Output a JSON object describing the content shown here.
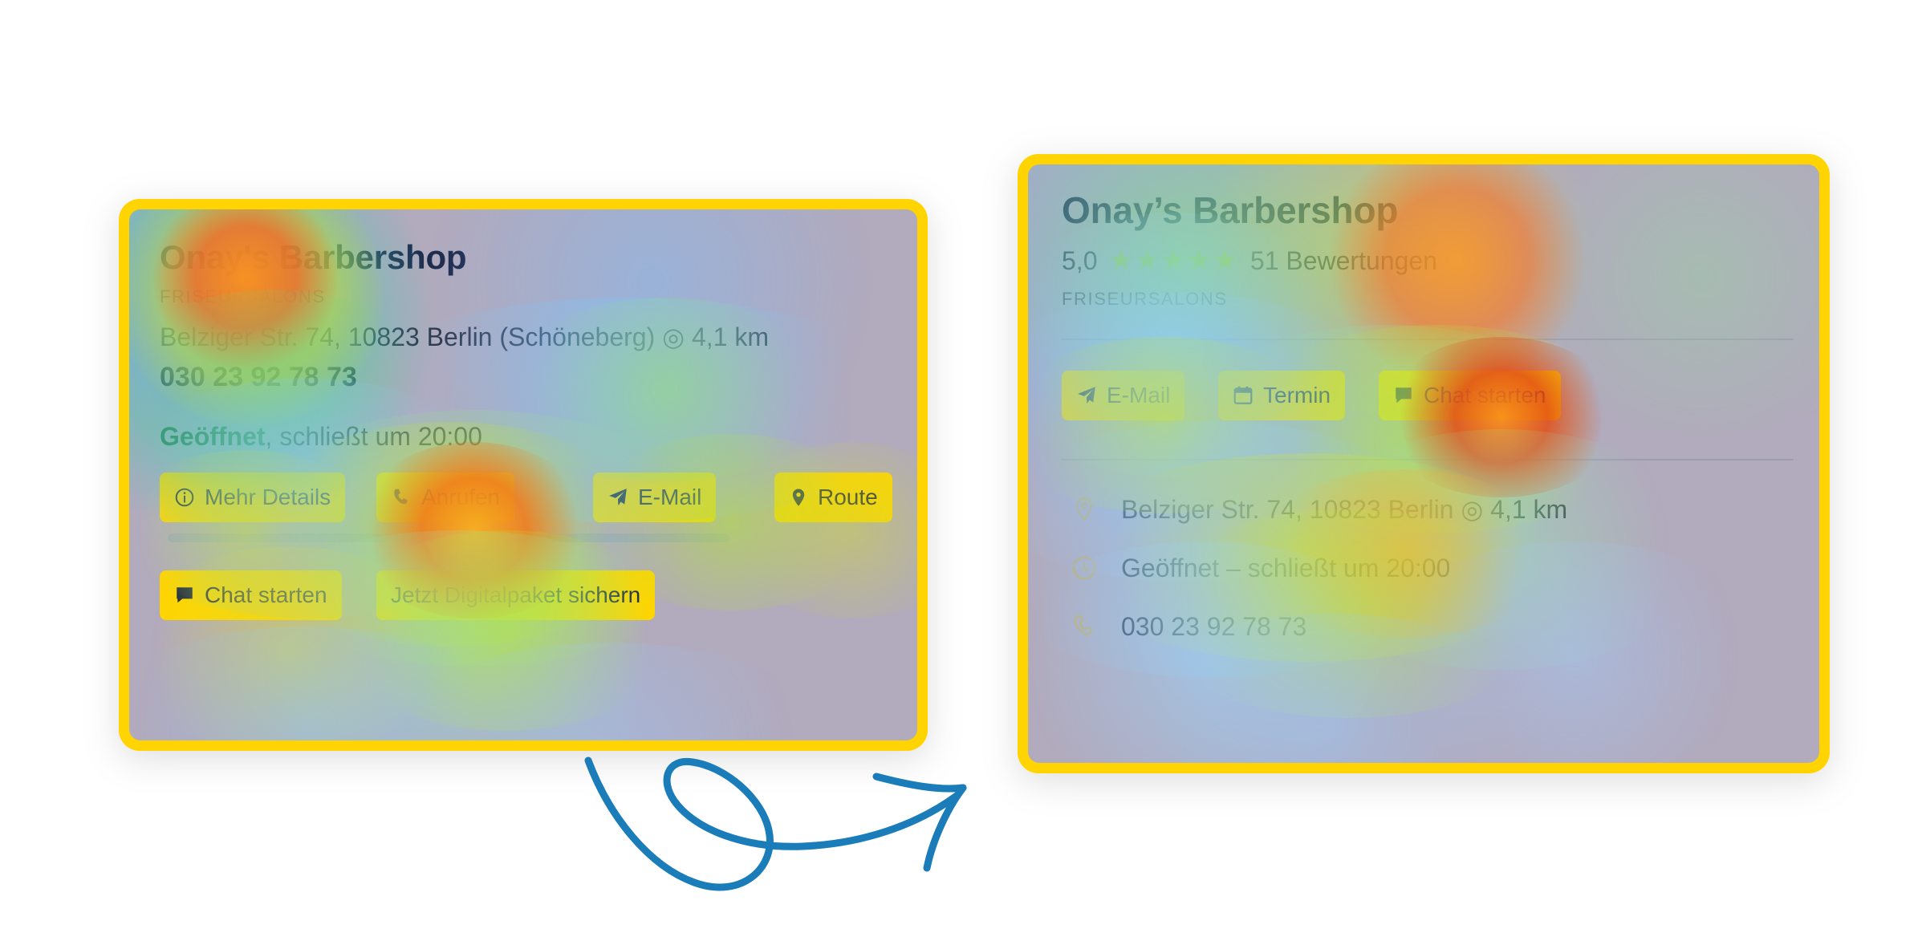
{
  "page": {
    "background_color": "#ffffff",
    "card_border_color": "#ffd400",
    "card_base_color": "#b2aabd",
    "arrow_color": "#1a7cb8"
  },
  "left_card": {
    "name": "Onay's Barbershop",
    "category": "FRISEURSALONS",
    "address_line": "Belziger Str. 74, 10823 Berlin (Schöneberg) ◎ 4,1 km",
    "phone": "030 23 92 78 73",
    "hours_strong": "Geöffnet",
    "hours_rest": ", schließt um 20:00",
    "buttons_row1": [
      {
        "label": "Mehr Details",
        "icon": "info-icon"
      },
      {
        "label": "Anrufen",
        "icon": "phone-icon"
      },
      {
        "label": "E-Mail",
        "icon": "paper-plane-icon"
      },
      {
        "label": "Route",
        "icon": "map-pin-icon"
      }
    ],
    "buttons_row2": [
      {
        "label": "Chat starten",
        "icon": "chat-bubble-icon"
      },
      {
        "label": "Jetzt Digitalpaket sichern",
        "icon": "none"
      }
    ]
  },
  "right_card": {
    "name": "Onay’s Barbershop",
    "rating_value": "5,0",
    "stars": "★★★★★",
    "review_count_label": "51 Bewertungen",
    "category": "FRISEURSALONS",
    "buttons": [
      {
        "label": "E-Mail",
        "icon": "paper-plane-icon"
      },
      {
        "label": "Termin",
        "icon": "calendar-icon"
      },
      {
        "label": "Chat starten",
        "icon": "chat-bubble-icon"
      }
    ],
    "info_rows": [
      {
        "icon": "map-pin-icon",
        "text": "Belziger Str. 74, 10823 Berlin ◎ 4,1 km"
      },
      {
        "icon": "clock-icon",
        "text": "Geöffnet – schließt um 20:00"
      },
      {
        "icon": "phone-icon",
        "text": "030 23 92 78 73"
      }
    ]
  },
  "heatmap": {
    "legend": [
      "blue-low",
      "green-mid",
      "yellow-high",
      "red-peak"
    ],
    "left_peaks": [
      "title-left",
      "anrufen-button"
    ],
    "right_peaks": [
      "title-right",
      "chat-starten-button"
    ]
  }
}
